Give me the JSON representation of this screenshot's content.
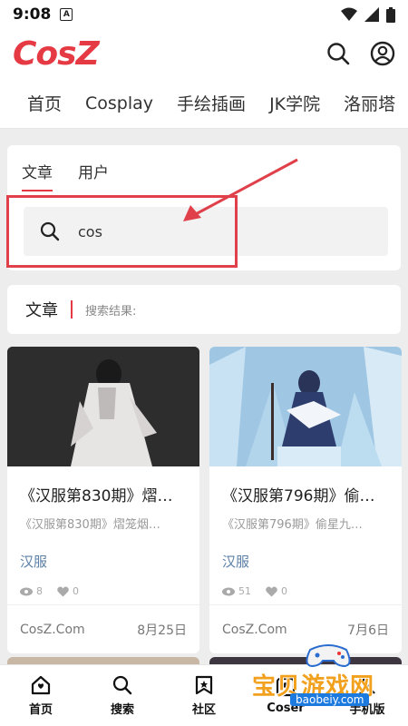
{
  "status_bar": {
    "time": "9:08",
    "a_icon": "A"
  },
  "header": {
    "logo": "CosZ"
  },
  "nav": {
    "items": [
      "首页",
      "Cosplay",
      "手绘插画",
      "JK学院",
      "洛丽塔"
    ]
  },
  "search": {
    "tabs": [
      {
        "label": "文章",
        "active": true
      },
      {
        "label": "用户",
        "active": false
      }
    ],
    "query": "cos"
  },
  "results": {
    "title": "文章",
    "label": "搜索结果:"
  },
  "cards": [
    {
      "title": "《汉服第830期》熠笼烟…",
      "excerpt": "《汉服第830期》熠笼烟…",
      "category": "汉服",
      "views": "8",
      "likes": "0",
      "site": "CosZ.Com",
      "date": "8月25日"
    },
    {
      "title": "《汉服第796期》偷星九…",
      "excerpt": "《汉服第796期》偷星九…",
      "category": "汉服",
      "views": "51",
      "likes": "0",
      "site": "CosZ.Com",
      "date": "7月6日"
    }
  ],
  "bottom_nav": {
    "items": [
      {
        "label": "首页",
        "icon": "home-icon"
      },
      {
        "label": "搜索",
        "icon": "search-icon"
      },
      {
        "label": "社区",
        "icon": "bookmark-icon"
      },
      {
        "label": "Coser",
        "icon": "coser-icon"
      },
      {
        "label": "手机版",
        "icon": "user-icon"
      }
    ]
  },
  "watermark": {
    "text": "宝贝游戏网",
    "url": "baobeiy.com"
  },
  "colors": {
    "accent": "#e53a43",
    "category": "#5b7fa6",
    "annotation": "#e0404a"
  }
}
